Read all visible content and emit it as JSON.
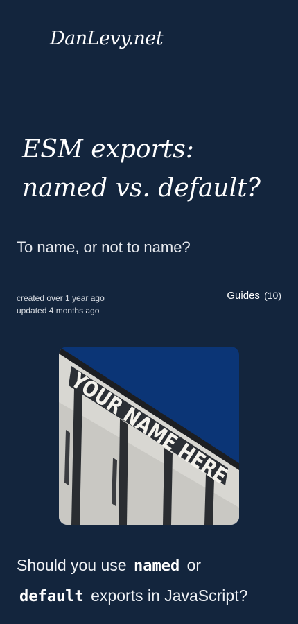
{
  "site": {
    "logo_text": "DanLevy.net"
  },
  "article": {
    "title_line1": "ESM exports:",
    "title_line2": "named vs. default?",
    "subtitle": "To name, or not to name?",
    "created": "created over 1 year ago",
    "updated": "updated 4 months ago",
    "category_label": "Guides",
    "category_count": "(10)",
    "hero_sign_text": "YOUR NAME HERE",
    "lead_part1": "Should you use",
    "lead_code1": "named",
    "lead_part2": "or",
    "lead_code2": "default",
    "lead_part3": "exports in JavaScript?"
  },
  "colors": {
    "background": "#13253d",
    "text": "#ffffff",
    "sky": "#0b3576"
  }
}
